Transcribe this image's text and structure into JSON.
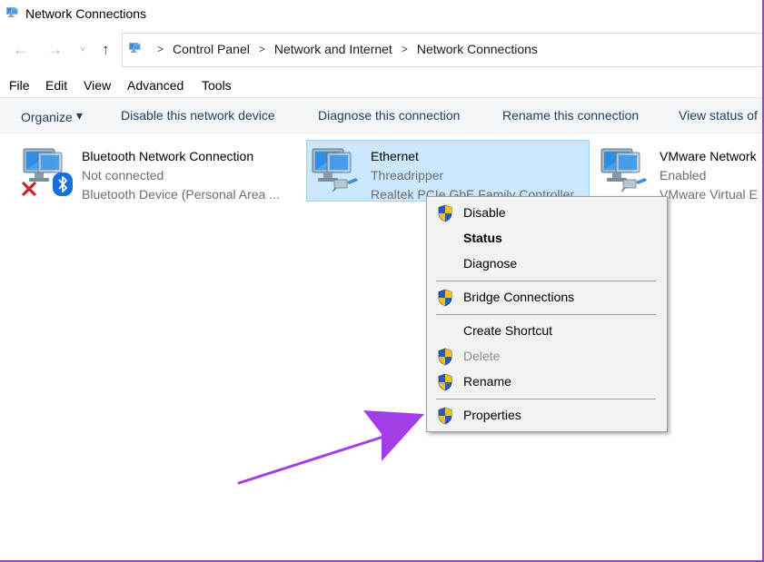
{
  "window": {
    "title": "Network Connections"
  },
  "nav": {
    "back_icon": "←",
    "forward_icon": "→",
    "recent_icon": "˅",
    "up_icon": "↑"
  },
  "breadcrumb": {
    "sep": ">",
    "items": [
      "Control Panel",
      "Network and Internet",
      "Network Connections"
    ]
  },
  "menubar": [
    "File",
    "Edit",
    "View",
    "Advanced",
    "Tools"
  ],
  "toolbar": {
    "organize": "Organize",
    "caret": "▾",
    "disable": "Disable this network device",
    "diagnose": "Diagnose this connection",
    "rename": "Rename this connection",
    "view_status": "View status of"
  },
  "connections": [
    {
      "name": "Bluetooth Network Connection",
      "status": "Not connected",
      "device": "Bluetooth Device (Personal Area ..."
    },
    {
      "name": "Ethernet",
      "status": "Threadripper",
      "device": "Realtek PCIe GbE Family Controller"
    },
    {
      "name": "VMware Network",
      "status": "Enabled",
      "device": "VMware Virtual E"
    }
  ],
  "context_menu": {
    "items": [
      {
        "label": "Disable",
        "icon": "uac-shield-icon"
      },
      {
        "label": "Status",
        "bold": true
      },
      {
        "label": "Diagnose"
      },
      {
        "label": "Bridge Connections",
        "icon": "uac-shield-icon"
      },
      {
        "label": "Create Shortcut"
      },
      {
        "label": "Delete",
        "icon": "uac-shield-icon",
        "disabled": true
      },
      {
        "label": "Rename",
        "icon": "uac-shield-icon"
      },
      {
        "label": "Properties",
        "icon": "uac-shield-icon"
      }
    ]
  },
  "colors": {
    "selection": "#cce8ff",
    "annotation_arrow": "#a23ee8",
    "frame": "#9a3fd0",
    "toolbar_text": "#1e3a5f"
  }
}
